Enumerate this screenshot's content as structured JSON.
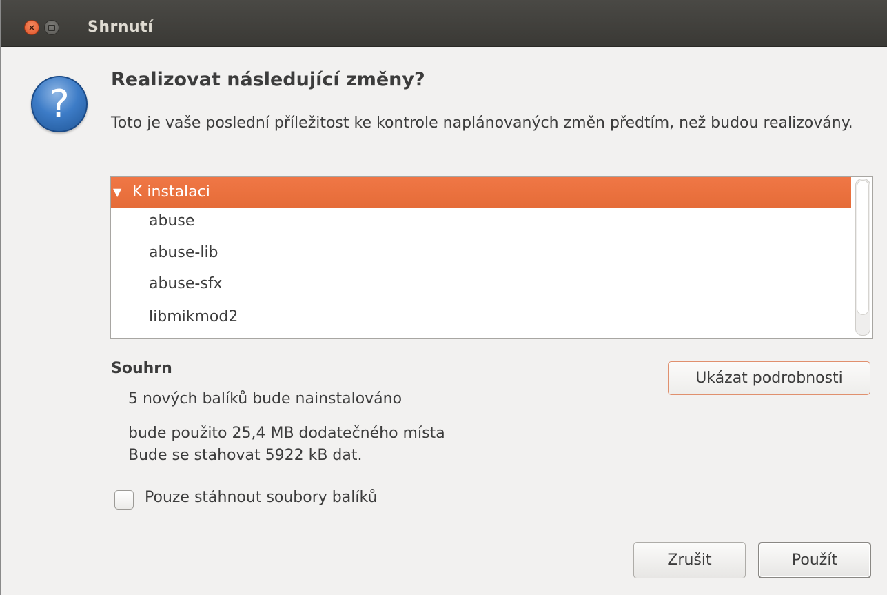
{
  "window": {
    "title": "Shrnutí"
  },
  "dialog": {
    "heading": "Realizovat následující změny?",
    "description": "Toto je vaše poslední příležitost ke kontrole naplánovaných změn předtím, než budou realizovány.",
    "icon": "question-icon"
  },
  "changes_list": {
    "group_label": "K instalaci",
    "group_expanded": true,
    "items": [
      "abuse",
      "abuse-lib",
      "abuse-sfx",
      "libmikmod2"
    ]
  },
  "summary": {
    "title": "Souhrn",
    "lines": [
      "5 nových balíků bude nainstalováno",
      "bude použito 25,4 MB dodatečného místa",
      "Bude se stahovat 5922 kB dat."
    ],
    "details_button": "Ukázat podrobnosti"
  },
  "download_only": {
    "label": "Pouze stáhnout soubory balíků",
    "checked": false
  },
  "buttons": {
    "cancel": "Zrušit",
    "apply": "Použít"
  },
  "colors": {
    "selection": "#f07746",
    "titlebar": "#3c3b37",
    "close_button": "#e95420"
  }
}
